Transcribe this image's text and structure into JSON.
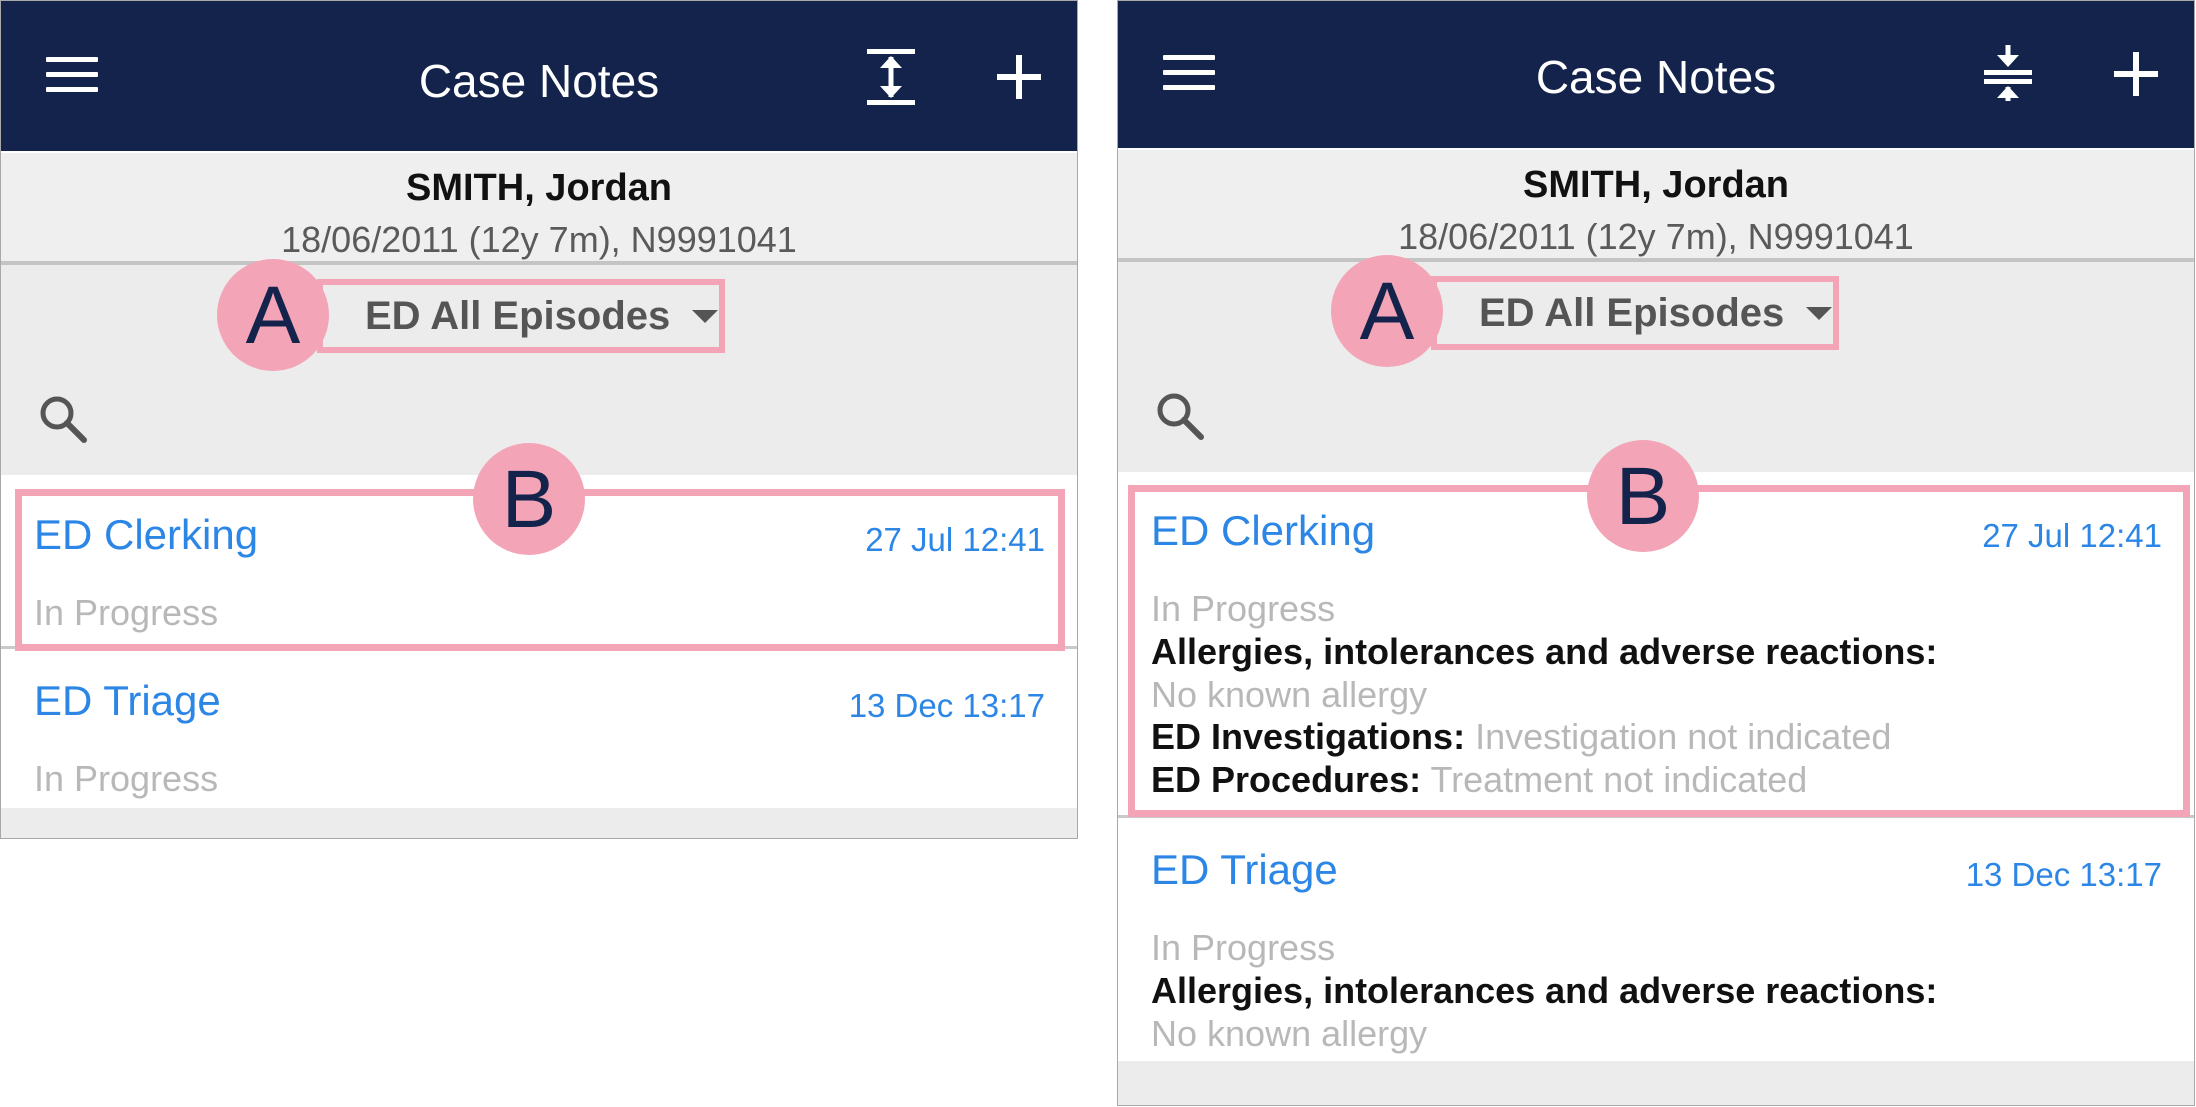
{
  "left": {
    "app_title": "Case Notes",
    "patient": {
      "name": "SMITH, Jordan",
      "details": "18/06/2011 (12y 7m), N9991041"
    },
    "episode_filter": "ED All Episodes",
    "callouts": {
      "a": "A",
      "b": "B"
    },
    "notes": [
      {
        "title": "ED Clerking",
        "time": "27 Jul 12:41",
        "status": "In Progress"
      },
      {
        "title": "ED Triage",
        "time": "13 Dec 13:17",
        "status": "In Progress"
      }
    ]
  },
  "right": {
    "app_title": "Case Notes",
    "patient": {
      "name": "SMITH, Jordan",
      "details": "18/06/2011 (12y 7m), N9991041"
    },
    "episode_filter": "ED All Episodes",
    "callouts": {
      "a": "A",
      "b": "B"
    },
    "notes": [
      {
        "title": "ED Clerking",
        "time": "27 Jul 12:41",
        "status": "In Progress",
        "allergies_label": "Allergies, intolerances and adverse reactions:",
        "allergies_value": "No known allergy",
        "investigations_label": "ED Investigations:",
        "investigations_value": "Investigation not indicated",
        "procedures_label": "ED Procedures:",
        "procedures_value": "Treatment not indicated"
      },
      {
        "title": "ED Triage",
        "time": "13 Dec 13:17",
        "status": "In Progress",
        "allergies_label": "Allergies, intolerances and adverse reactions:",
        "allergies_value": "No known allergy"
      }
    ]
  },
  "icons": {
    "menu": "menu-icon",
    "expand": "expand-all-icon",
    "collapse": "collapse-all-icon",
    "add": "plus-icon",
    "search": "search-icon",
    "dropdown": "caret-down-icon"
  },
  "colors": {
    "appbar": "#14234b",
    "highlight": "#f3a4b6",
    "link": "#2b86e6",
    "muted_text": "#b8b8b8"
  }
}
